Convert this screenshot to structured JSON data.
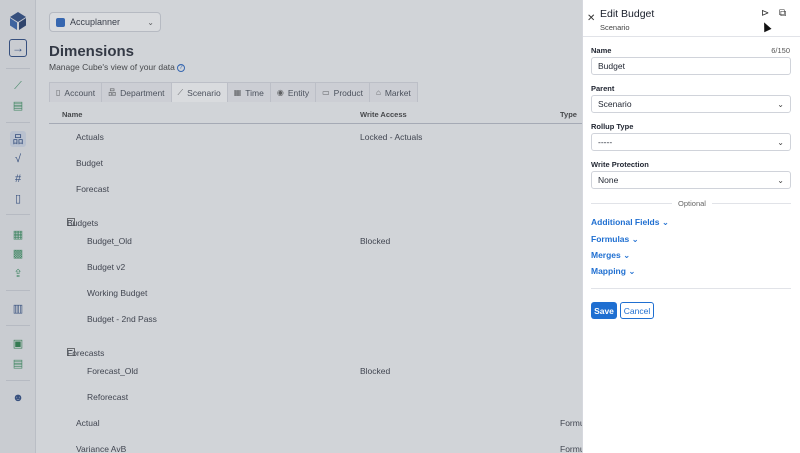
{
  "header": {
    "app_name": "Accuplanner",
    "title": "Dimensions",
    "subtitle": "Manage Cube's view of your data"
  },
  "tabs": [
    {
      "label": "Account",
      "icon": "ledger-icon"
    },
    {
      "label": "Department",
      "icon": "org-chart-icon"
    },
    {
      "label": "Scenario",
      "icon": "line-chart-icon",
      "active": true
    },
    {
      "label": "Time",
      "icon": "calendar-icon"
    },
    {
      "label": "Entity",
      "icon": "location-pin-icon"
    },
    {
      "label": "Product",
      "icon": "box-icon"
    },
    {
      "label": "Market",
      "icon": "store-icon"
    }
  ],
  "table": {
    "columns": [
      "Name",
      "Write Access",
      "Type"
    ],
    "rows": [
      {
        "name": "Actuals",
        "access": "Locked - Actuals",
        "type": ""
      },
      {
        "name": "Budget",
        "access": "",
        "type": ""
      },
      {
        "name": "Forecast",
        "access": "",
        "type": ""
      },
      {
        "name": "Budgets",
        "access": "",
        "type": "",
        "collapsible": true
      },
      {
        "name": "Budget_Old",
        "access": "Blocked",
        "type": ""
      },
      {
        "name": "Budget v2",
        "access": "",
        "type": ""
      },
      {
        "name": "Working Budget",
        "access": "",
        "type": ""
      },
      {
        "name": "Budget - 2nd Pass",
        "access": "",
        "type": ""
      },
      {
        "name": "Forecasts",
        "access": "",
        "type": "",
        "collapsible": true
      },
      {
        "name": "Forecast_Old",
        "access": "Blocked",
        "type": ""
      },
      {
        "name": "Reforecast",
        "access": "",
        "type": ""
      },
      {
        "name": "Actual",
        "access": "",
        "type": "Formu"
      },
      {
        "name": "Variance AvB",
        "access": "",
        "type": "Formu"
      }
    ]
  },
  "drawer": {
    "title": "Edit Budget",
    "subtitle": "Scenario",
    "name_label": "Name",
    "name_count": "6/150",
    "name_value": "Budget",
    "parent_label": "Parent",
    "parent_value": "Scenario",
    "rollup_label": "Rollup Type",
    "rollup_value": "-----",
    "protection_label": "Write Protection",
    "protection_value": "None",
    "optional_label": "Optional",
    "sections": [
      "Additional Fields",
      "Formulas",
      "Merges",
      "Mapping"
    ],
    "save_label": "Save",
    "cancel_label": "Cancel"
  },
  "colors": {
    "accent": "#1f6fd1",
    "brand": "#1f3f7a"
  }
}
